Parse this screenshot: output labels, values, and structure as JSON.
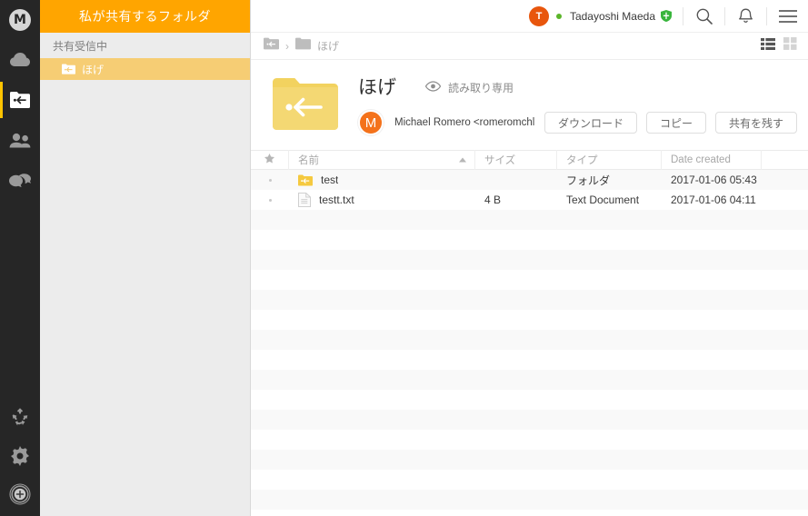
{
  "app": {
    "logo_letter": "M",
    "logo_name": "mega-logo-icon"
  },
  "rail": {
    "items": [
      {
        "name": "cloud-drive-icon",
        "label": "Cloud Drive",
        "active": false
      },
      {
        "name": "shared-folders-icon",
        "label": "Shared with me",
        "active": true
      },
      {
        "name": "contacts-icon",
        "label": "Contacts",
        "active": false
      },
      {
        "name": "chat-icon",
        "label": "Chat",
        "active": false
      }
    ],
    "bottom_items": [
      {
        "name": "transfers-sync-icon",
        "label": "Transfers"
      },
      {
        "name": "gear-icon",
        "label": "Settings"
      },
      {
        "name": "achievements-icon",
        "label": "Achievements"
      }
    ]
  },
  "panel": {
    "title": "私が共有するフォルダ",
    "section_label": "共有受信中",
    "rows": [
      {
        "label": "ほげ",
        "selected": true
      }
    ]
  },
  "topbar": {
    "avatar_initial": "T",
    "user_name": "Tadayoshi Maeda",
    "status": "online",
    "badge": "pro-shield-icon",
    "search_icon": "search-icon",
    "notifications_icon": "bell-icon",
    "menu_icon": "hamburger-menu-icon"
  },
  "breadcrumb": {
    "root_icon": "shared-folder-icon",
    "separator": "›",
    "current": "ほげ",
    "view_list": "list-view-icon",
    "view_grid": "grid-view-icon",
    "active_view": "list"
  },
  "info": {
    "folder_icon": "shared-folder-large-icon",
    "title": "ほげ",
    "permission_icon": "eye-icon",
    "permission_label": "読み取り専用",
    "owner_initial": "M",
    "owner_text": "Michael Romero  <romeromchl@",
    "buttons": [
      {
        "label": "ダウンロード",
        "name": "download-button"
      },
      {
        "label": "コピー",
        "name": "copy-button"
      },
      {
        "label": "共有を残す",
        "name": "leave-share-button"
      }
    ]
  },
  "table": {
    "columns": [
      {
        "key": "star",
        "label": "★"
      },
      {
        "key": "name",
        "label": "名前",
        "sorted": "asc"
      },
      {
        "key": "size",
        "label": "サイズ"
      },
      {
        "key": "type",
        "label": "タイプ"
      },
      {
        "key": "date",
        "label": "Date created"
      },
      {
        "key": "last",
        "label": ""
      }
    ],
    "rows": [
      {
        "icon": "folder-shared-icon",
        "name": "test",
        "size": "",
        "type": "フォルダ",
        "date": "2017-01-06 05:43"
      },
      {
        "icon": "text-document-icon",
        "name": "testt.txt",
        "size": "4 B",
        "type": "Text Document",
        "date": "2017-01-06 04:11"
      }
    ],
    "empty_row_count": 15
  },
  "colors": {
    "brand_orange": "#ffa500",
    "selection_amber": "#f6cd74",
    "rail_dark": "#262626",
    "panel_grey": "#ececec",
    "accent_yellow": "#ffc400",
    "avatar_orange": "#e8560d",
    "status_green": "#5bb52a"
  }
}
